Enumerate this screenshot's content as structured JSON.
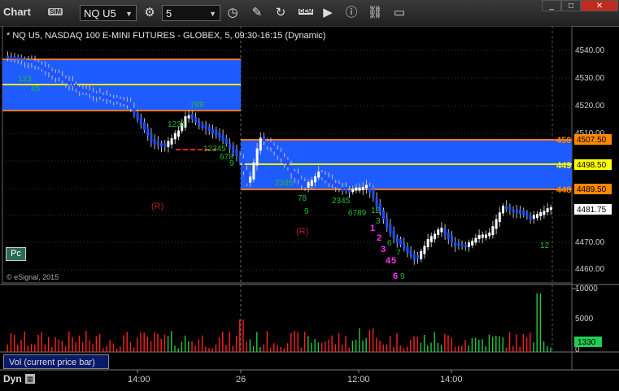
{
  "app": {
    "title": "Chart",
    "sim_badge": "SIM"
  },
  "toolbar": {
    "symbol": "NQ U5",
    "interval": "5",
    "gem_badge": "GEM"
  },
  "chart": {
    "header": "* NQ U5, NASDAQ 100 E-MINI FUTURES - GLOBEX, 5, 09:30-16:15 (Dynamic)",
    "watermark": "© eSignal, 2015",
    "pc_button": "Pc",
    "price_axis": [
      "4540.00",
      "4530.00",
      "4520.00",
      "4510.00",
      "4470.00",
      "4460.00"
    ],
    "price_tags": [
      {
        "value": "4507.50",
        "color": "#ff8800"
      },
      {
        "value": "4498.50",
        "color": "#ffff00"
      },
      {
        "value": "4489.50",
        "color": "#ff8800"
      },
      {
        "value": "4481.75",
        "color": "#ffffff"
      }
    ],
    "edge_labels": [
      "450",
      "449",
      "448"
    ],
    "r_marks": [
      "(R)",
      "(R)"
    ],
    "counts_magenta": [
      "1",
      "2",
      "3",
      "4",
      "5",
      "6"
    ],
    "time_labels": [
      "14:00",
      "26",
      "12:00",
      "14:00"
    ]
  },
  "volume": {
    "tab_label": "Vol (current price bar)",
    "axis": [
      "10000",
      "5000",
      "0"
    ],
    "current": "1330"
  },
  "footer": {
    "dyn_label": "Dyn"
  },
  "colors": {
    "band": "#1f5cff",
    "orange_line": "#ff7a1a",
    "yellow_line": "#f4f000",
    "up_bar": "#ffffff",
    "down_bar": "#1f4fff"
  }
}
